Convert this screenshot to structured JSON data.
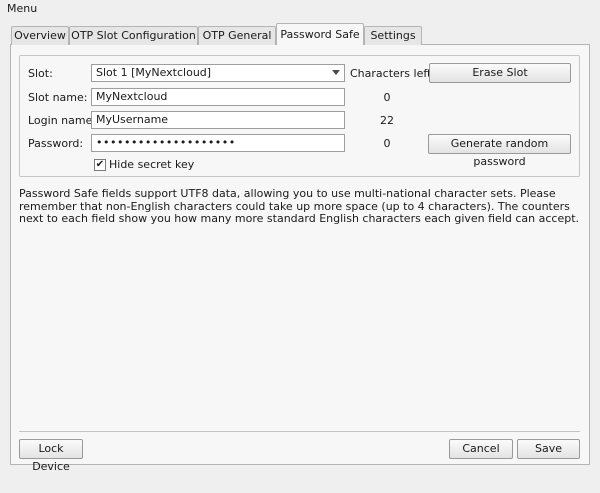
{
  "menubar": {
    "menu_label": "Menu"
  },
  "tabs": [
    {
      "label": "Overview",
      "active": false
    },
    {
      "label": "OTP Slot Configuration",
      "active": false
    },
    {
      "label": "OTP General",
      "active": false
    },
    {
      "label": "Password Safe",
      "active": true
    },
    {
      "label": "Settings",
      "active": false
    }
  ],
  "form": {
    "slot_label": "Slot:",
    "slot_value": "Slot 1 [MyNextcloud]",
    "characters_left_label": "Characters left:",
    "erase_slot_label": "Erase Slot",
    "slot_name_label": "Slot name:",
    "slot_name_value": "MyNextcloud",
    "slot_name_count": "0",
    "login_name_label": "Login name:",
    "login_name_value": "MyUsername",
    "login_name_count": "22",
    "password_label": "Password:",
    "password_value": "••••••••••••••••••••",
    "password_count": "0",
    "generate_label": "Generate random password",
    "hide_secret_label": "Hide secret key",
    "hide_secret_checked": true,
    "checkmark": "✔"
  },
  "description": "Password Safe fields support UTF8 data, allowing you to use multi-national character sets. Please remember that non-English characters could take up more space (up to 4 characters). The counters next to each field show you how many more standard English characters each given field can accept.",
  "footer": {
    "lock_label": "Lock Device",
    "cancel_label": "Cancel",
    "save_label": "Save"
  }
}
